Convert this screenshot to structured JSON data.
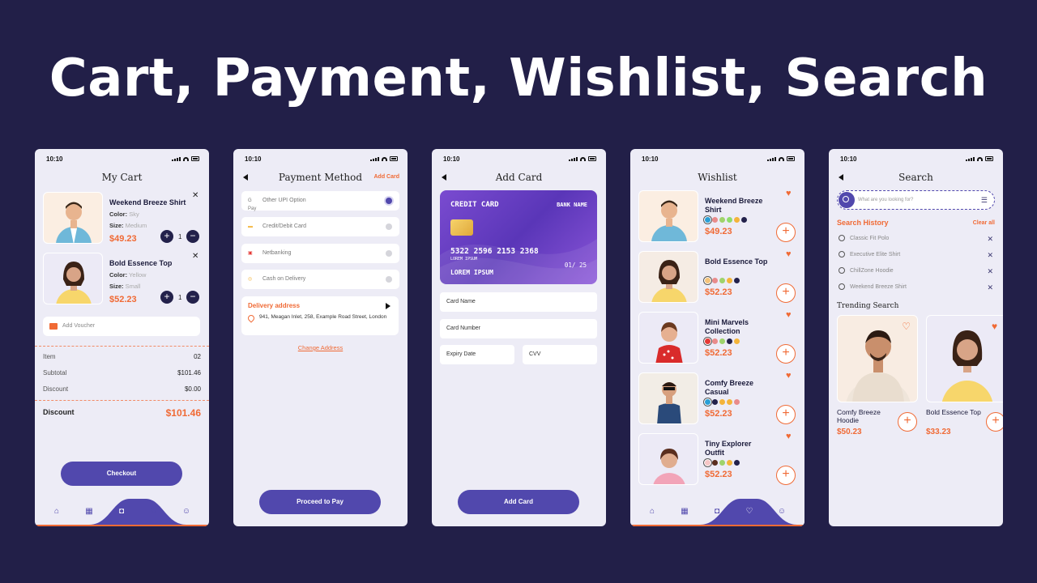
{
  "title": "Cart, Payment, Wishlist, Search",
  "status_time": "10:10",
  "cart": {
    "header": "My Cart",
    "items": [
      {
        "name": "Weekend Breeze Shirt",
        "color_label": "Color:",
        "color": "Sky",
        "size_label": "Size:",
        "size": "Medium",
        "price": "$49.23",
        "qty": "1"
      },
      {
        "name": "Bold Essence Top",
        "color_label": "Color:",
        "color": "Yellow",
        "size_label": "Size:",
        "size": "Small",
        "price": "$52.23",
        "qty": "1"
      }
    ],
    "voucher_placeholder": "Add Voucher",
    "summary": [
      {
        "label": "Item",
        "value": "02"
      },
      {
        "label": "Subtotal",
        "value": "$101.46"
      },
      {
        "label": "Discount",
        "value": "$0.00"
      }
    ],
    "total_label": "Discount",
    "total_value": "$101.46",
    "checkout": "Checkout"
  },
  "payment": {
    "header": "Payment Method",
    "add_card": "Add Card",
    "options": [
      {
        "logo": "G Pay",
        "label": "Other UPI Option",
        "selected": true
      },
      {
        "logo": "▬",
        "label": "Credit/Debit Card",
        "selected": false
      },
      {
        "logo": "▣",
        "label": "Netbanking",
        "selected": false
      },
      {
        "logo": "◎",
        "label": "Cash on Delivery",
        "selected": false
      }
    ],
    "delivery_title": "Delivery address",
    "delivery_address": "941, Meagan Inlet, 258, Example Road Street, London",
    "change_address": "Change Address",
    "proceed": "Proceed to Pay"
  },
  "addcard": {
    "header": "Add Card",
    "card_type": "CREDIT CARD",
    "bank": "BANK NAME",
    "number": "5322 2596 2153 2368",
    "small_text": "LOREM IPSUM",
    "expiry": "01/ 25",
    "holder": "LOREM IPSUM",
    "fields": {
      "name": "Card Name",
      "number": "Card Number",
      "expiry": "Expiry Date",
      "cvv": "CVV"
    },
    "button": "Add Card"
  },
  "wishlist": {
    "header": "Wishlist",
    "items": [
      {
        "name": "Weekend Breeze Shirt",
        "price": "$49.23",
        "colors": [
          "#2a9fd6",
          "#e98b8b",
          "#9fd36b",
          "#8fdc6b",
          "#f4b43a",
          "#23214b"
        ]
      },
      {
        "name": "Bold Essence Top",
        "price": "$52.23",
        "colors": [
          "#f4c37a",
          "#e98b8b",
          "#9fd36b",
          "#f4b43a",
          "#23214b"
        ]
      },
      {
        "name": "Mini Marvels Collection",
        "price": "$52.23",
        "colors": [
          "#e53935",
          "#e98b8b",
          "#9fd36b",
          "#23214b",
          "#f4b43a"
        ]
      },
      {
        "name": "Comfy Breeze Casual",
        "price": "$52.23",
        "colors": [
          "#2a9fd6",
          "#23214b",
          "#f4b43a",
          "#f4b43a",
          "#e98b8b"
        ]
      },
      {
        "name": "Tiny Explorer Outfit",
        "price": "$52.23",
        "colors": [
          "#f6c6c6",
          "#5a2e1e",
          "#9fd36b",
          "#f4b43a",
          "#23214b"
        ]
      }
    ]
  },
  "search": {
    "header": "Search",
    "placeholder": "What are you looking for?",
    "history_title": "Search History",
    "clear_all": "Clear all",
    "history": [
      "Classic Fit Polo",
      "Executive Elite Shirt",
      "ChillZone Hoodie",
      "Weekend Breeze Shirt"
    ],
    "trending_title": "Trending Search",
    "trending": [
      {
        "name": "Comfy Breeze Hoodie",
        "price": "$50.23"
      },
      {
        "name": "Bold Essence Top",
        "price": "$33.23"
      }
    ]
  },
  "colors": {
    "accent": "#f06a35",
    "primary": "#5148ad",
    "background": "#221f48"
  }
}
